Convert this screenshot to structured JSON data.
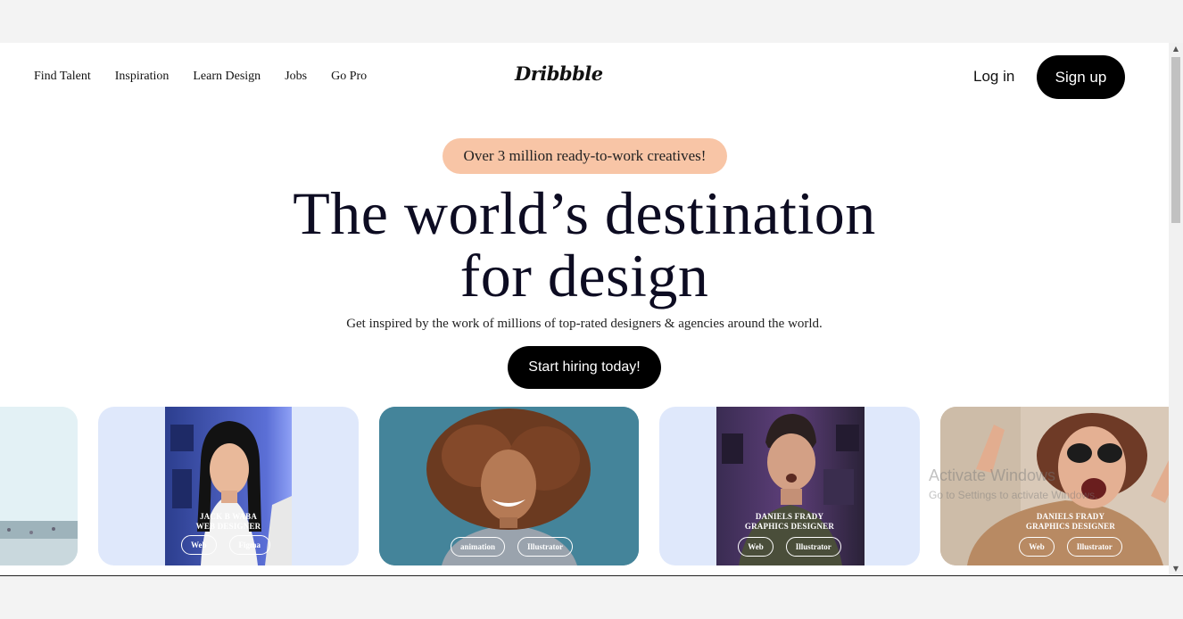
{
  "header": {
    "nav": [
      "Find Talent",
      "Inspiration",
      "Learn Design",
      "Jobs",
      "Go Pro"
    ],
    "logo": "Dribbble",
    "login": "Log in",
    "signup": "Sign up"
  },
  "hero": {
    "pill": "Over 3 million ready-to-work creatives!",
    "headline_line1": "The world’s destination",
    "headline_line2": "for design",
    "subtitle": "Get inspired by the work of millions of top-rated designers & agencies around the world.",
    "cta": "Start hiring today!"
  },
  "cards": [
    {
      "name_line1": "JACK B WABA",
      "name_line2": "WEB DESIGNER",
      "tags": [
        "Web",
        "Figma"
      ]
    },
    {
      "name_line1": "",
      "name_line2": "",
      "tags": [
        "animation",
        "Illustrator"
      ]
    },
    {
      "name_line1": "DANIELS FRADY",
      "name_line2": "GRAPHICS DESIGNER",
      "tags": [
        "Web",
        "Illustrator"
      ]
    },
    {
      "name_line1": "DANIELS FRADY",
      "name_line2": "GRAPHICS DESIGNER",
      "tags": [
        "Web",
        "Illustrator"
      ]
    }
  ],
  "watermark": {
    "line1": "Activate Windows",
    "line2": "Go to Settings to activate Windows."
  },
  "colors": {
    "pill_bg": "#f8c5a6",
    "card_bg_light": "#dfe8fb",
    "card_bg_teal": "#3f7e92",
    "button_bg": "#000000"
  }
}
